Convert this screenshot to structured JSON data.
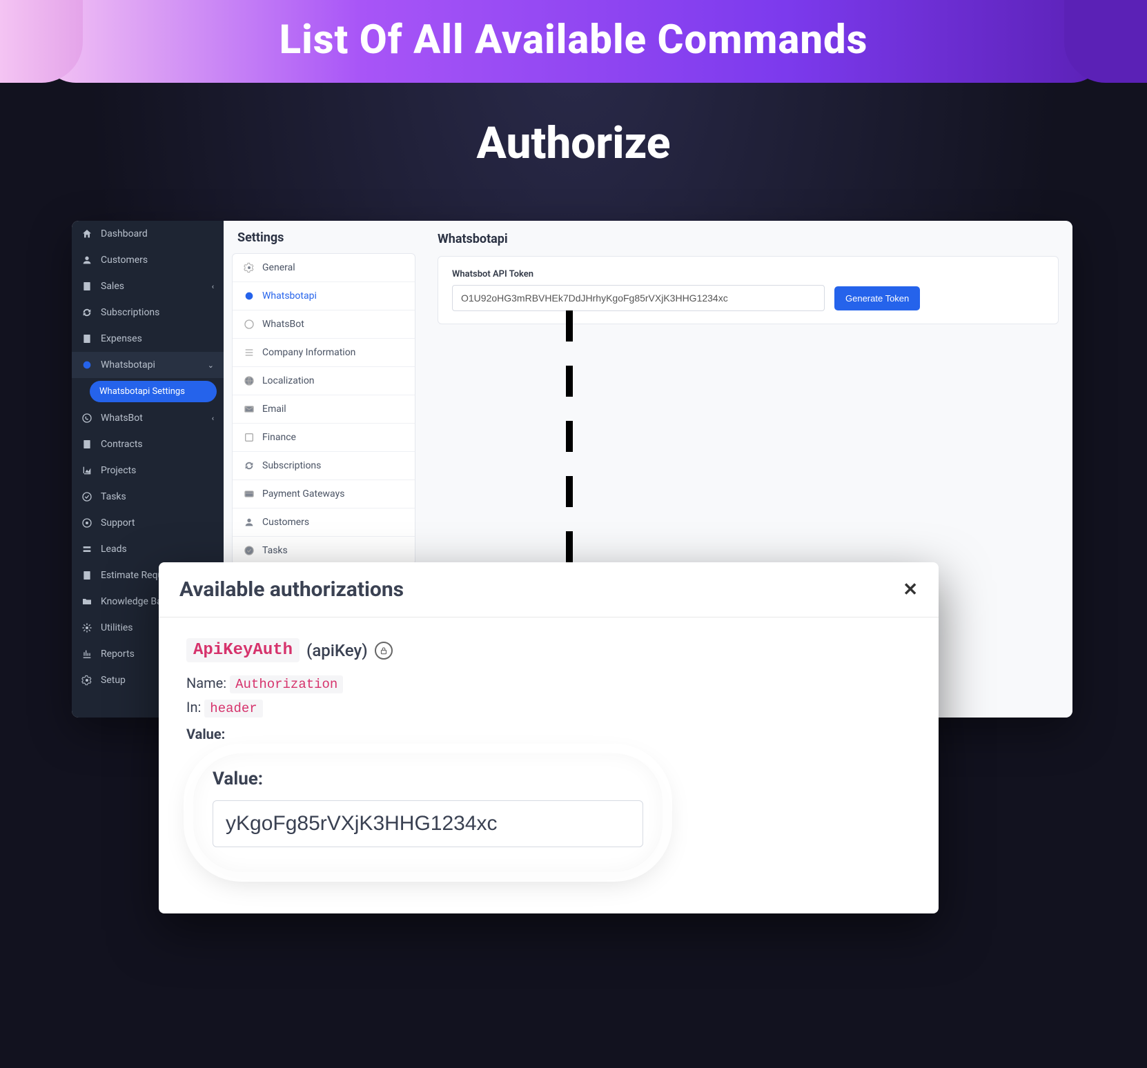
{
  "banner": {
    "title": "List Of All Available Commands"
  },
  "subtitle": "Authorize",
  "sidebar": {
    "items": [
      {
        "label": "Dashboard",
        "icon": "home"
      },
      {
        "label": "Customers",
        "icon": "user"
      },
      {
        "label": "Sales",
        "icon": "file",
        "expandable": true
      },
      {
        "label": "Subscriptions",
        "icon": "refresh"
      },
      {
        "label": "Expenses",
        "icon": "file"
      },
      {
        "label": "Whatsbotapi",
        "icon": "circle",
        "expandable": true,
        "active": true,
        "sub": "Whatsbotapi Settings"
      },
      {
        "label": "WhatsBot",
        "icon": "whatsapp",
        "expandable": true
      },
      {
        "label": "Contracts",
        "icon": "file"
      },
      {
        "label": "Projects",
        "icon": "chart"
      },
      {
        "label": "Tasks",
        "icon": "check"
      },
      {
        "label": "Support",
        "icon": "support"
      },
      {
        "label": "Leads",
        "icon": "leads"
      },
      {
        "label": "Estimate Request",
        "icon": "file"
      },
      {
        "label": "Knowledge Base",
        "icon": "folder"
      },
      {
        "label": "Utilities",
        "icon": "gear"
      },
      {
        "label": "Reports",
        "icon": "report"
      },
      {
        "label": "Setup",
        "icon": "setup"
      }
    ]
  },
  "settings": {
    "title": "Settings",
    "items": [
      {
        "label": "General",
        "icon": "gear"
      },
      {
        "label": "Whatsbotapi",
        "icon": "circle",
        "active": true
      },
      {
        "label": "WhatsBot",
        "icon": "whatsapp"
      },
      {
        "label": "Company Information",
        "icon": "list"
      },
      {
        "label": "Localization",
        "icon": "globe"
      },
      {
        "label": "Email",
        "icon": "mail"
      },
      {
        "label": "Finance",
        "icon": "finance"
      },
      {
        "label": "Subscriptions",
        "icon": "refresh"
      },
      {
        "label": "Payment Gateways",
        "icon": "card"
      },
      {
        "label": "Customers",
        "icon": "user"
      },
      {
        "label": "Tasks",
        "icon": "check"
      }
    ]
  },
  "content": {
    "title": "Whatsbotapi",
    "field_label": "Whatsbot API Token",
    "token_value": "O1U92oHG3mRBVHEk7DdJHrhyKgoFg85rVXjK3HHG1234xc",
    "generate_btn": "Generate Token"
  },
  "modal": {
    "title": "Available authorizations",
    "auth_scheme": "ApiKeyAuth",
    "auth_type": "(apiKey)",
    "name_label": "Name:",
    "name_value": "Authorization",
    "in_label": "In:",
    "in_value": "header",
    "value_label": "Value:",
    "highlight_label": "Value:",
    "highlight_value": "yKgoFg85rVXjK3HHG1234xc"
  }
}
